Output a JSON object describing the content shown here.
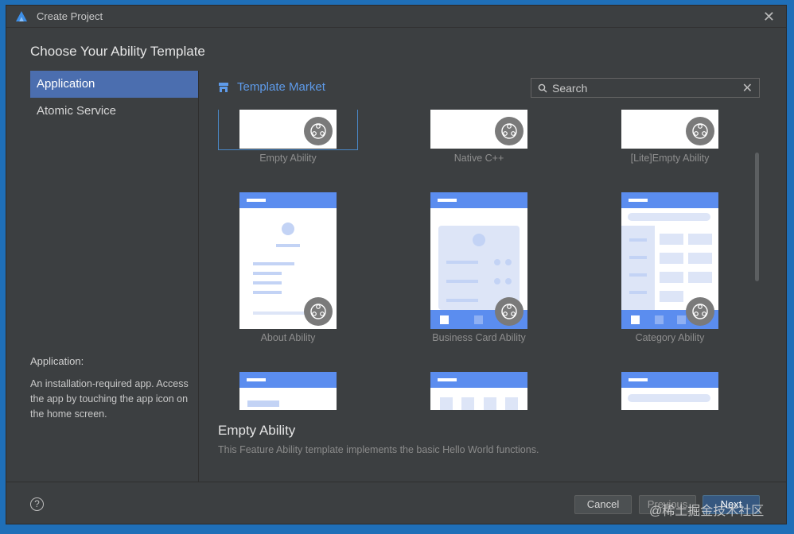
{
  "window": {
    "title": "Create Project"
  },
  "heading": "Choose Your Ability Template",
  "sidebar": {
    "items": [
      {
        "label": "Application",
        "active": true
      },
      {
        "label": "Atomic Service",
        "active": false
      }
    ],
    "description_title": "Application:",
    "description": "An installation-required app. Access the app by touching the app icon on the home screen."
  },
  "market": {
    "label": "Template Market",
    "icon": "store-icon"
  },
  "search": {
    "value": "Search",
    "placeholder": "Search"
  },
  "templates": [
    {
      "name": "Empty Ability",
      "selected": true
    },
    {
      "name": "Native C++",
      "selected": false
    },
    {
      "name": "[Lite]Empty Ability",
      "selected": false
    },
    {
      "name": "About Ability",
      "selected": false
    },
    {
      "name": "Business Card Ability",
      "selected": false
    },
    {
      "name": "Category Ability",
      "selected": false
    },
    {
      "name": "",
      "selected": false
    },
    {
      "name": "",
      "selected": false
    },
    {
      "name": "",
      "selected": false
    }
  ],
  "selected_template": {
    "title": "Empty Ability",
    "description": "This Feature Ability template implements the basic Hello World functions."
  },
  "buttons": {
    "cancel": "Cancel",
    "previous": "Previous",
    "next": "Next",
    "help": "?"
  },
  "watermark": "@稀土掘金技术社区",
  "colors": {
    "accent": "#4b6eaf",
    "link": "#5e9bea",
    "template_blue": "#5b8def",
    "background": "#3c3f41"
  }
}
